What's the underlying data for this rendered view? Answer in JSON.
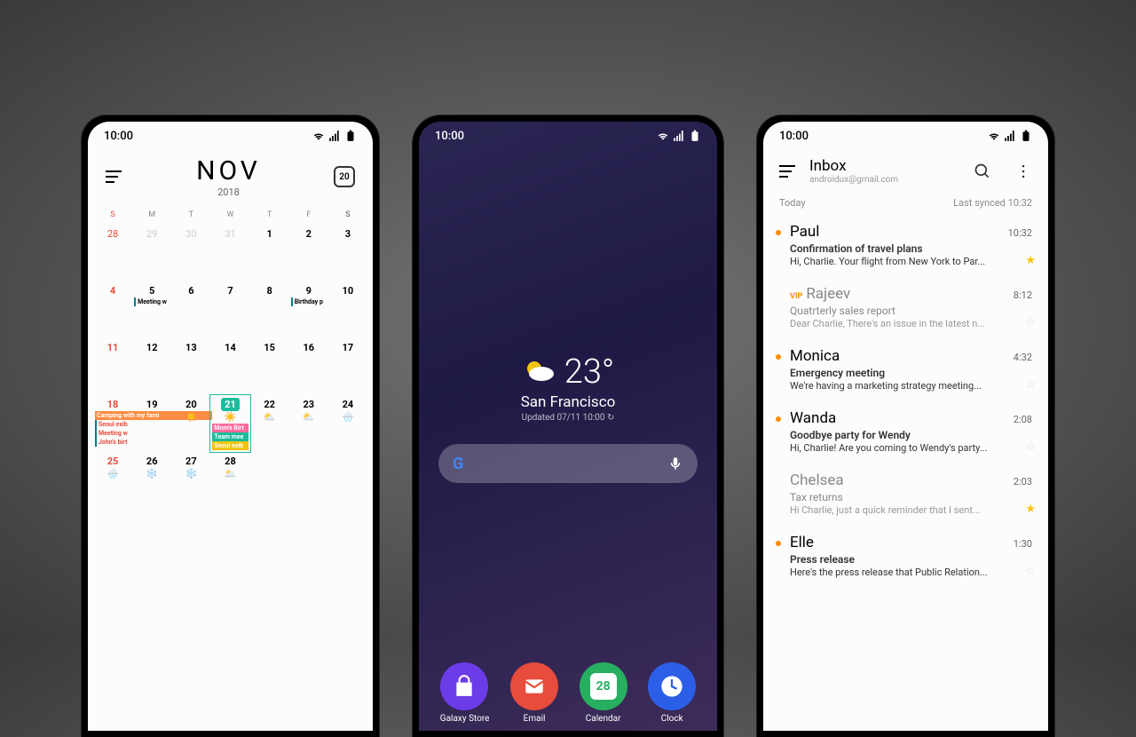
{
  "status_time": "10:00",
  "calendar": {
    "month": "NOV",
    "year": "2018",
    "today_badge": "20",
    "daynames": [
      "S",
      "M",
      "T",
      "W",
      "T",
      "F",
      "S"
    ],
    "weeks": [
      [
        {
          "n": "28",
          "dim": true,
          "sun": true
        },
        {
          "n": "29",
          "dim": true
        },
        {
          "n": "30",
          "dim": true
        },
        {
          "n": "31",
          "dim": true
        },
        {
          "n": "1"
        },
        {
          "n": "2"
        },
        {
          "n": "3"
        }
      ],
      [
        {
          "n": "4",
          "sun": true
        },
        {
          "n": "5",
          "ev": [
            {
              "t": "Meeting w",
              "c": ""
            }
          ]
        },
        {
          "n": "6"
        },
        {
          "n": "7"
        },
        {
          "n": "8"
        },
        {
          "n": "9",
          "ev": [
            {
              "t": "Birthday p",
              "c": ""
            }
          ]
        },
        {
          "n": "10"
        }
      ],
      [
        {
          "n": "11",
          "sun": true
        },
        {
          "n": "12"
        },
        {
          "n": "13"
        },
        {
          "n": "14"
        },
        {
          "n": "15"
        },
        {
          "n": "16"
        },
        {
          "n": "17"
        }
      ],
      [
        {
          "n": "18",
          "sun": true,
          "ev": [
            {
              "t": "Camping with my fami",
              "c": "orange",
              "span": 3
            },
            {
              "t": "Seoul exib",
              "c": ""
            },
            {
              "t": "Meeting w",
              "c": ""
            },
            {
              "t": "John's birt",
              "c": ""
            }
          ]
        },
        {
          "n": "19"
        },
        {
          "n": "20",
          "w": "☀️"
        },
        {
          "n": "21",
          "today": true,
          "w": "☀️",
          "ev": [
            {
              "t": "Mom's Birt",
              "c": "pink"
            },
            {
              "t": "Team mee",
              "c": "teal"
            },
            {
              "t": "Seoul exib",
              "c": "yellow"
            }
          ]
        },
        {
          "n": "22",
          "w": "⛅"
        },
        {
          "n": "23",
          "w": "⛅"
        },
        {
          "n": "24",
          "w": "🌧️"
        }
      ],
      [
        {
          "n": "25",
          "sun": true,
          "w": "🌧️"
        },
        {
          "n": "26",
          "w": "❄️"
        },
        {
          "n": "27",
          "w": "❄️"
        },
        {
          "n": "28",
          "w": "🌥️"
        },
        {
          "n": "",
          "blank": true
        },
        {
          "n": "",
          "blank": true
        },
        {
          "n": "",
          "blank": true
        }
      ]
    ]
  },
  "home": {
    "temp": "23°",
    "city": "San Francisco",
    "updated": "Updated 07/11 10:00 ↻",
    "dock": [
      {
        "label": "Galaxy Store",
        "glyph": "🛍️",
        "class": "di-store"
      },
      {
        "label": "Email",
        "glyph": "✉",
        "class": "di-email"
      },
      {
        "label": "Calendar",
        "glyph": "28",
        "class": "di-cal"
      },
      {
        "label": "Clock",
        "glyph": "🕐",
        "class": "di-clock"
      }
    ]
  },
  "email": {
    "title": "Inbox",
    "account": "androidux@gmail.com",
    "section": "Today",
    "synced": "Last synced 10:32",
    "items": [
      {
        "sender": "Paul",
        "time": "10:32",
        "subject": "Confirmation of travel plans",
        "preview": "Hi, Charlie. Your flight from New York to Par...",
        "unread": true,
        "star": true,
        "vip": false
      },
      {
        "sender": "Rajeev",
        "time": "8:12",
        "subject": "Quatrterly sales report",
        "preview": "Dear Charlie, There's an issue in the latest n...",
        "unread": false,
        "star": false,
        "vip": true
      },
      {
        "sender": "Monica",
        "time": "4:32",
        "subject": "Emergency meeting",
        "preview": "We're having a marketing strategy meeting...",
        "unread": true,
        "star": false,
        "vip": false
      },
      {
        "sender": "Wanda",
        "time": "2:08",
        "subject": "Goodbye party for Wendy",
        "preview": "Hi, Charlie! Are you coming to Wendy's party...",
        "unread": true,
        "star": false,
        "vip": false
      },
      {
        "sender": "Chelsea",
        "time": "2:03",
        "subject": "Tax returns",
        "preview": "Hi Charlie, just a quick reminder that I sent...",
        "unread": false,
        "star": true,
        "vip": false
      },
      {
        "sender": "Elle",
        "time": "1:30",
        "subject": "Press release",
        "preview": "Here's the press release that Public Relation...",
        "unread": true,
        "star": false,
        "vip": false
      }
    ]
  }
}
